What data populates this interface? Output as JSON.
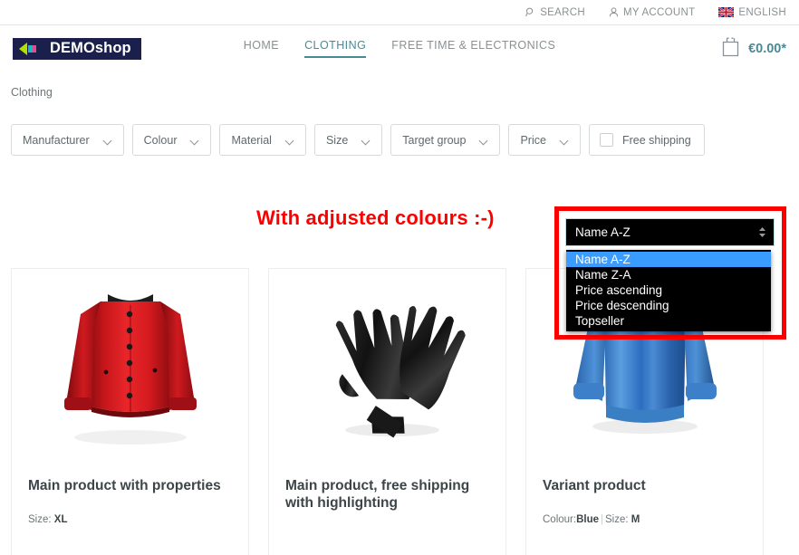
{
  "topbar": {
    "items": [
      {
        "label": "SEARCH",
        "icon": "search-icon"
      },
      {
        "label": "MY ACCOUNT",
        "icon": "account-icon"
      },
      {
        "label": "ENGLISH",
        "icon": "uk-flag-icon"
      }
    ]
  },
  "header": {
    "logo_text": "DEMOshop",
    "nav": [
      {
        "label": "HOME",
        "active": false
      },
      {
        "label": "CLOTHING",
        "active": true
      },
      {
        "label": "FREE TIME & ELECTRONICS",
        "active": false
      }
    ],
    "cart": {
      "icon": "shopping-bag-icon",
      "amount": "€0.00*"
    }
  },
  "breadcrumb": {
    "text": "Clothing"
  },
  "filters": {
    "dropdowns": [
      {
        "label": "Manufacturer"
      },
      {
        "label": "Colour"
      },
      {
        "label": "Material"
      },
      {
        "label": "Size"
      },
      {
        "label": "Target group"
      },
      {
        "label": "Price"
      }
    ],
    "checkbox": {
      "label": "Free shipping",
      "checked": false
    }
  },
  "annotation": {
    "text": "With adjusted colours :-)",
    "color": "#fc0000"
  },
  "sort": {
    "highlight_color": "#fc0000",
    "selected": "Name A-Z",
    "options": [
      {
        "label": "Name A-Z",
        "selected": true
      },
      {
        "label": "Name Z-A",
        "selected": false
      },
      {
        "label": "Price ascending",
        "selected": false
      },
      {
        "label": "Price descending",
        "selected": false
      },
      {
        "label": "Topseller",
        "selected": false
      }
    ]
  },
  "products": [
    {
      "title": "Main product with properties",
      "image": "red-jacket-photo",
      "meta_prefix": "Size:",
      "meta_value": "XL",
      "meta_prefix2": "",
      "meta_value2": ""
    },
    {
      "title": "Main product, free shipping with highlighting",
      "image": "black-gloves-photo",
      "meta_prefix": "",
      "meta_value": "",
      "meta_prefix2": "",
      "meta_value2": ""
    },
    {
      "title": "Variant product",
      "image": "blue-sweatshirt-photo",
      "meta_prefix": "Colour:",
      "meta_value": "Blue",
      "meta_prefix2": "Size:",
      "meta_value2": "M"
    }
  ]
}
